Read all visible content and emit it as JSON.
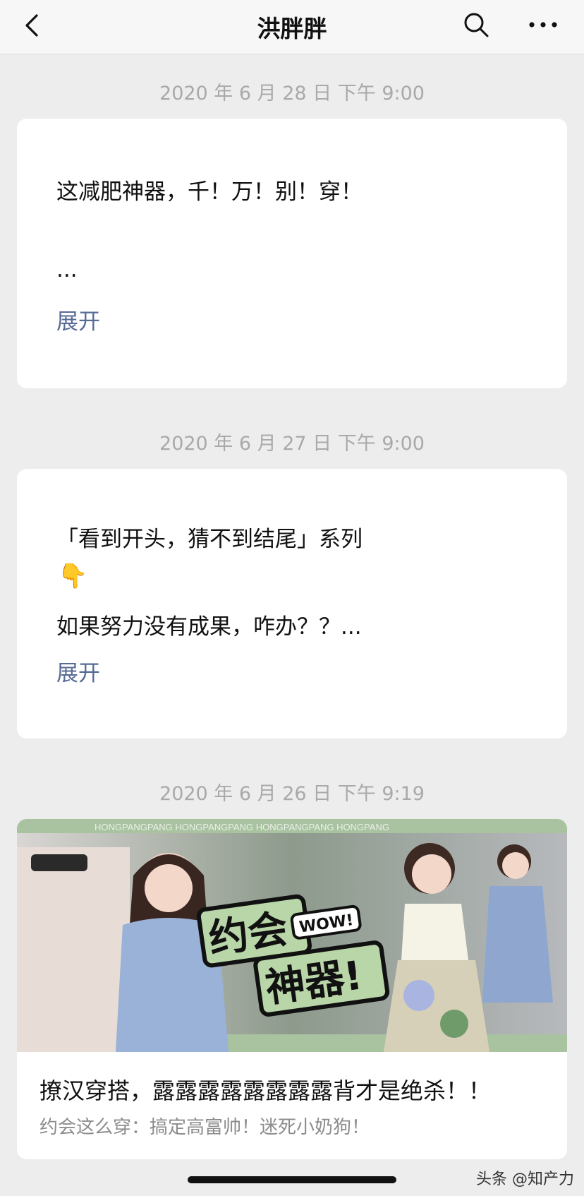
{
  "nav": {
    "title": "洪胖胖",
    "back_icon": "chevron-left-icon",
    "search_icon": "search-icon",
    "more_icon": "more-icon"
  },
  "posts": [
    {
      "date": "2020 年 6 月 28 日 下午 9:00",
      "line1": "这减肥神器，千！万！别！穿！",
      "line2": "...",
      "expand": "展开"
    },
    {
      "date": "2020 年 6 月 27 日 下午 9:00",
      "line1": "「看到开头，猜不到结尾」系列",
      "emoji": "👇",
      "line2": "如果努力没有成果，咋办？？...",
      "expand": "展开"
    },
    {
      "date": "2020 年 6 月 26 日 下午 9:19",
      "banner_pattern": "HONGPANGPANG HONGPANGPANG HONGPANGPANG HONGPANG",
      "banner_line1": "约会",
      "banner_wow": "WOW!",
      "banner_line2": "神器!",
      "title": "撩汉穿搭，露露露露露露露露背才是绝杀！！",
      "subtitle": "约会这么穿：搞定高富帅！迷死小奶狗！"
    }
  ],
  "watermark": "头条 @知产力",
  "colors": {
    "accent_link": "#576b95",
    "banner_green": "#a9c3a1"
  }
}
